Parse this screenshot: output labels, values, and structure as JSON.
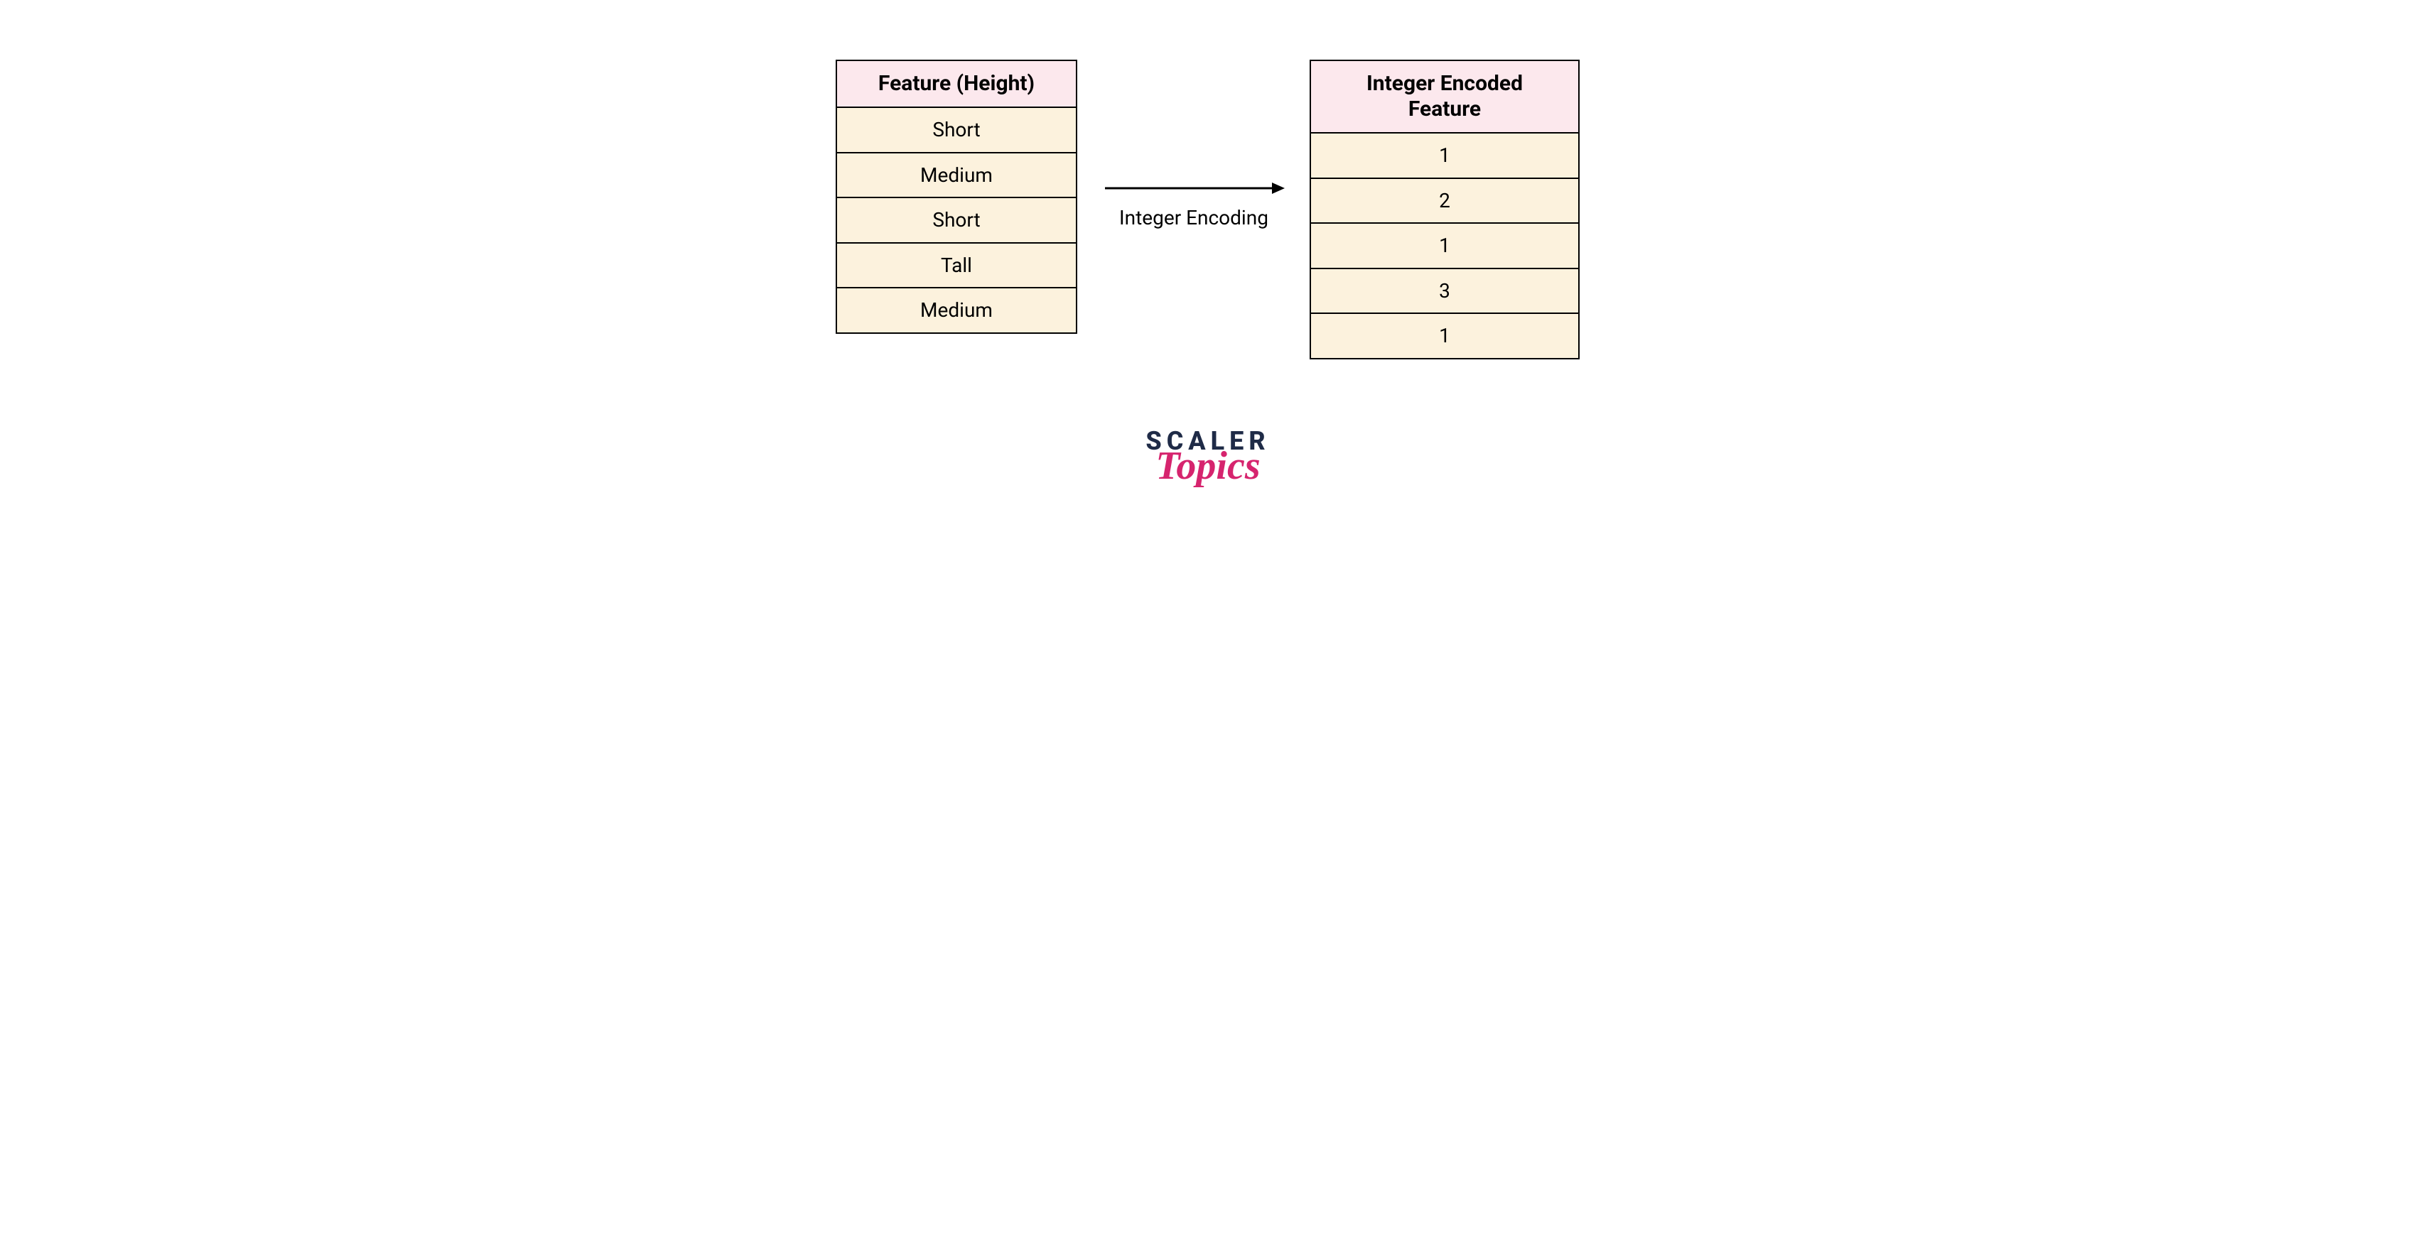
{
  "chart_data": {
    "type": "table",
    "mapping_label": "Integer Encoding",
    "source": {
      "header": "Feature (Height)",
      "rows": [
        "Short",
        "Medium",
        "Short",
        "Tall",
        "Medium"
      ]
    },
    "target": {
      "header": "Integer Encoded Feature",
      "rows": [
        "1",
        "2",
        "1",
        "3",
        "1"
      ]
    }
  },
  "brand": {
    "line1": "SCALER",
    "line2": "Topics"
  }
}
